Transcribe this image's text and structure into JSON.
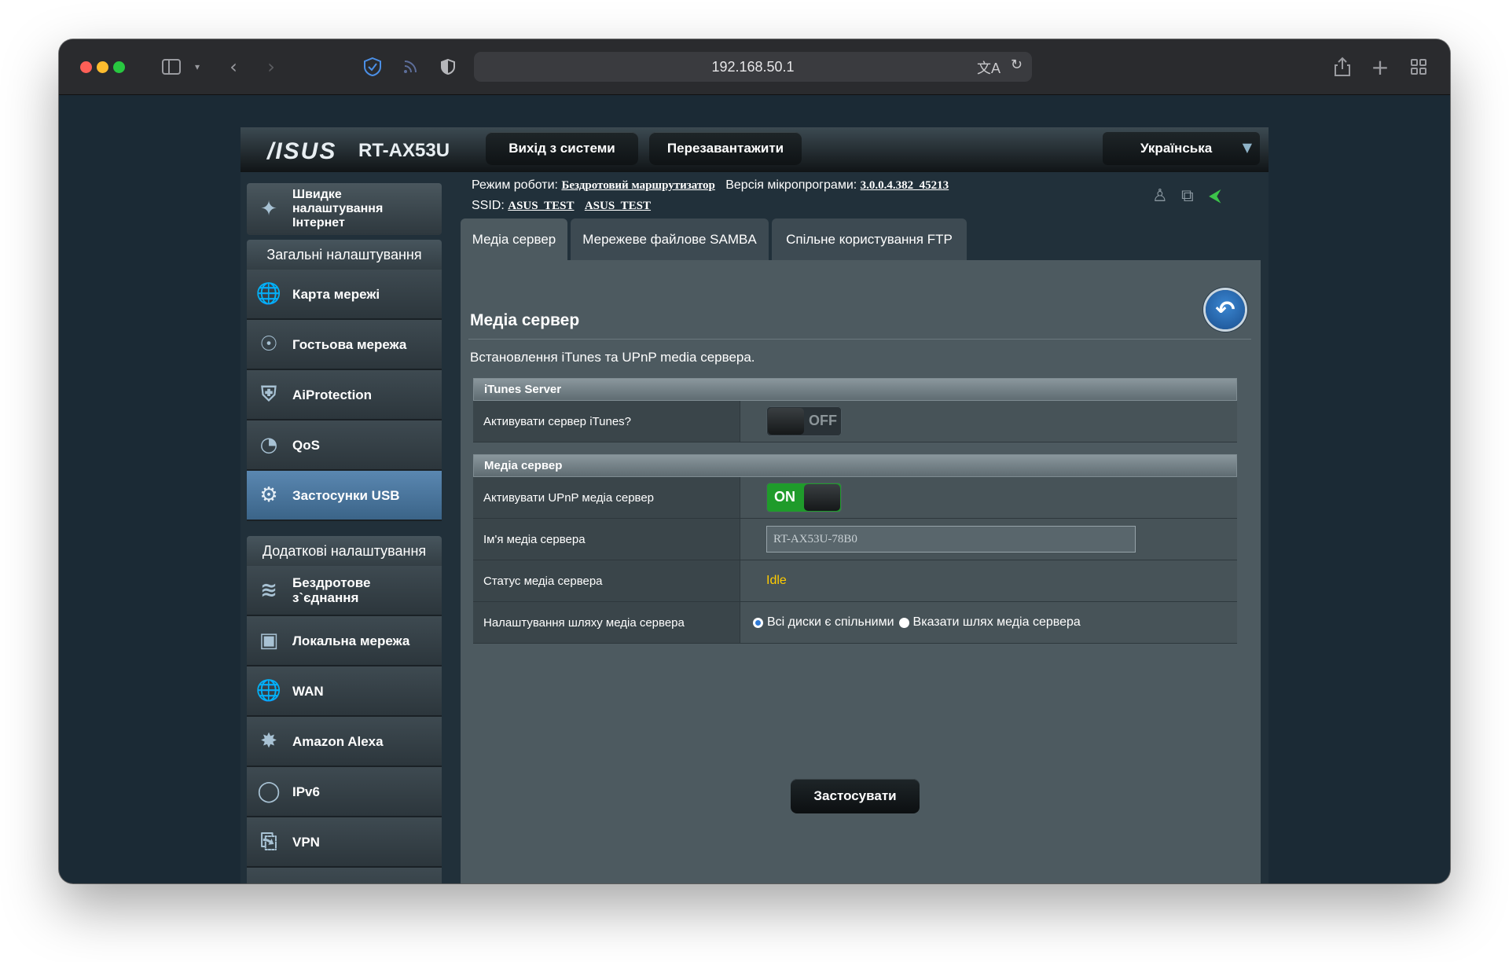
{
  "browser": {
    "url": "192.168.50.1",
    "colors": {
      "close": "#ff5f57",
      "minimize": "#febc2e",
      "zoom": "#28c840"
    },
    "icons": [
      "sidebar-icon",
      "chevron-down-icon",
      "back-icon",
      "forward-icon",
      "shield-icon",
      "rss-icon",
      "privacy-icon",
      "translate-icon",
      "reload-icon",
      "share-icon",
      "new-tab-icon",
      "tabs-overview-icon"
    ]
  },
  "router": {
    "logo": "/ISUS",
    "model": "RT-AX53U",
    "logout_label": "Вихід з системи",
    "reboot_label": "Перезавантажити",
    "language": "Українська",
    "mode_label": "Режим роботи:",
    "mode_value": "Бездротовий маршрутизатор",
    "firmware_label": "Версія мікропрограми:",
    "firmware_value": "3.0.0.4.382_45213",
    "ssid_label": "SSID:",
    "ssid_values": [
      "ASUS_TEST",
      "ASUS_TEST"
    ]
  },
  "sidebar": {
    "quick": "Швидке налаштування Інтернет",
    "general_header": "Загальні налаштування",
    "general_items": [
      {
        "label": "Карта мережі",
        "icon": "globe-icon"
      },
      {
        "label": "Гостьова мережа",
        "icon": "guest-network-icon"
      },
      {
        "label": "AiProtection",
        "icon": "lock-shield-icon"
      },
      {
        "label": "QoS",
        "icon": "gauge-icon"
      },
      {
        "label": "Застосунки USB",
        "icon": "usb-app-icon"
      }
    ],
    "advanced_header": "Додаткові налаштування",
    "advanced_items": [
      {
        "label": "Бездротове з`єднання",
        "icon": "wireless-icon"
      },
      {
        "label": "Локальна мережа",
        "icon": "lan-icon"
      },
      {
        "label": "WAN",
        "icon": "wan-globe-icon"
      },
      {
        "label": "Amazon Alexa",
        "icon": "alexa-icon"
      },
      {
        "label": "IPv6",
        "icon": "ipv6-icon"
      },
      {
        "label": "VPN",
        "icon": "vpn-icon"
      }
    ]
  },
  "tabs": [
    "Медіа сервер",
    "Мережеве файлове SAMBA",
    "Спільне користування FTP"
  ],
  "content": {
    "title": "Медіа сервер",
    "description": "Встановлення iTunes та UPnP media сервера.",
    "itunes": {
      "header": "iTunes Server",
      "enable_label": "Активувати сервер iTunes?",
      "enable_state": "OFF"
    },
    "media": {
      "header": "Медіа сервер",
      "upnp_label": "Активувати UPnP медіа сервер",
      "upnp_state": "ON",
      "name_label": "Ім'я медіа сервера",
      "name_value": "RT-AX53U-78B0",
      "status_label": "Статус медіа сервера",
      "status_value": "Idle",
      "path_label": "Налаштування шляху медіа сервера",
      "path_option_all": "Всі диски є спільними",
      "path_option_custom": "Вказати шлях медіа сервера"
    },
    "apply_label": "Застосувати"
  }
}
